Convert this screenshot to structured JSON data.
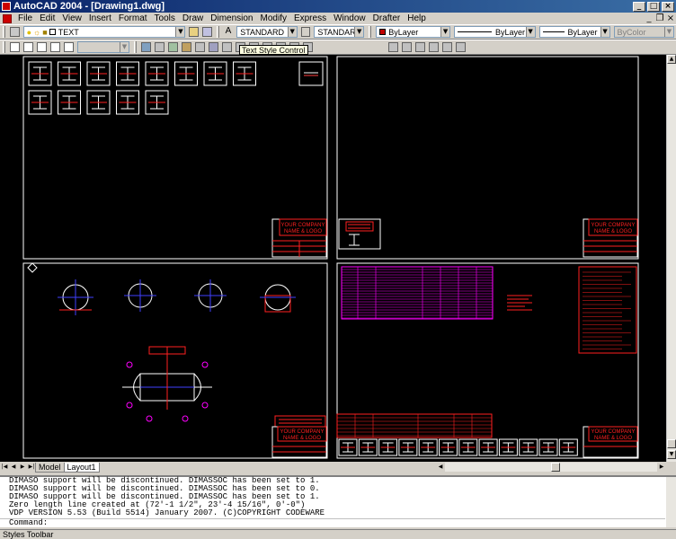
{
  "window": {
    "title": "AutoCAD 2004 - [Drawing1.dwg]"
  },
  "menu": {
    "items": [
      "File",
      "Edit",
      "View",
      "Insert",
      "Format",
      "Tools",
      "Draw",
      "Dimension",
      "Modify",
      "Express",
      "Window",
      "Drafter",
      "Help"
    ]
  },
  "toolbar": {
    "layer_value": "TEXT",
    "text_style": "STANDARD",
    "dim_style": "STANDARD",
    "color_value": "ByLayer",
    "linetype_value": "ByLayer",
    "lineweight_value": "ByLayer",
    "plotstyle_value": "ByColor"
  },
  "tooltip": "Text Style Control",
  "title_block": {
    "company": "YOUR COMPANY",
    "logo": "NAME & LOGO"
  },
  "tabs": [
    "Model",
    "Layout1"
  ],
  "command": {
    "lines": [
      "DIMASO support will be discontinued. DIMASSOC has been set to 1.",
      "DIMASO support will be discontinued. DIMASSOC has been set to 0.",
      "DIMASO support will be discontinued. DIMASSOC has been set to 1.",
      "Zero length line created at (72'-1 1/2\", 23'-4 15/16\", 0'-0\")",
      "VDP VERSION 5.53 (Build 5514) January 2007. (C)COPYRIGHT CODEWARE"
    ],
    "prompt": "Command:"
  },
  "status": "Styles Toolbar",
  "colors": {
    "accent_red": "#ff2020",
    "magenta": "#ff00ff",
    "canvas": "#000000",
    "titlebar": "#0a246a"
  }
}
